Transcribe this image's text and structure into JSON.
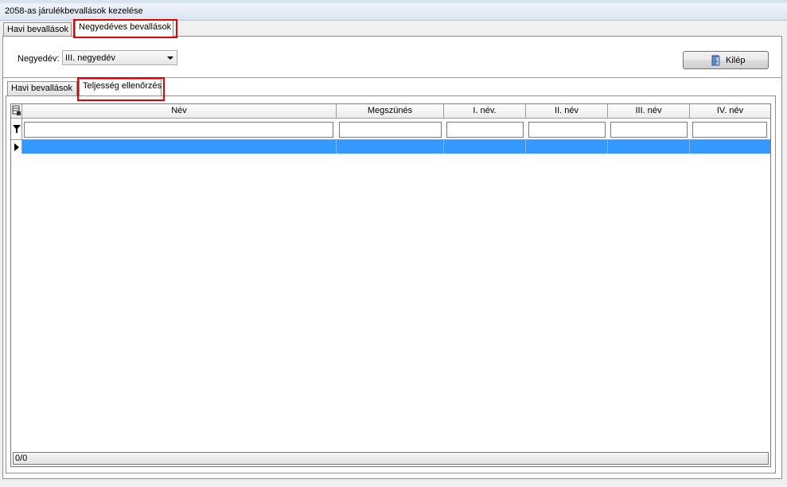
{
  "window": {
    "title": "2058-as járulékbevallások kezelése"
  },
  "outer_tabs": [
    {
      "label": "Havi bevallások"
    },
    {
      "label": "Negyedéves bevallások"
    }
  ],
  "quarter": {
    "label": "Negyedév:",
    "selected": "III. negyedév"
  },
  "exit_button": {
    "label": "Kilép"
  },
  "inner_tabs": [
    {
      "label": "Havi bevallások"
    },
    {
      "label": "Teljesség ellenőrzés"
    }
  ],
  "grid": {
    "columns": [
      "Név",
      "Megszünés",
      "I. név.",
      "II. név",
      "III. név",
      "IV. név"
    ],
    "status": "0/0"
  },
  "colors": {
    "highlight": "#e00000",
    "selection": "#3399ff"
  }
}
